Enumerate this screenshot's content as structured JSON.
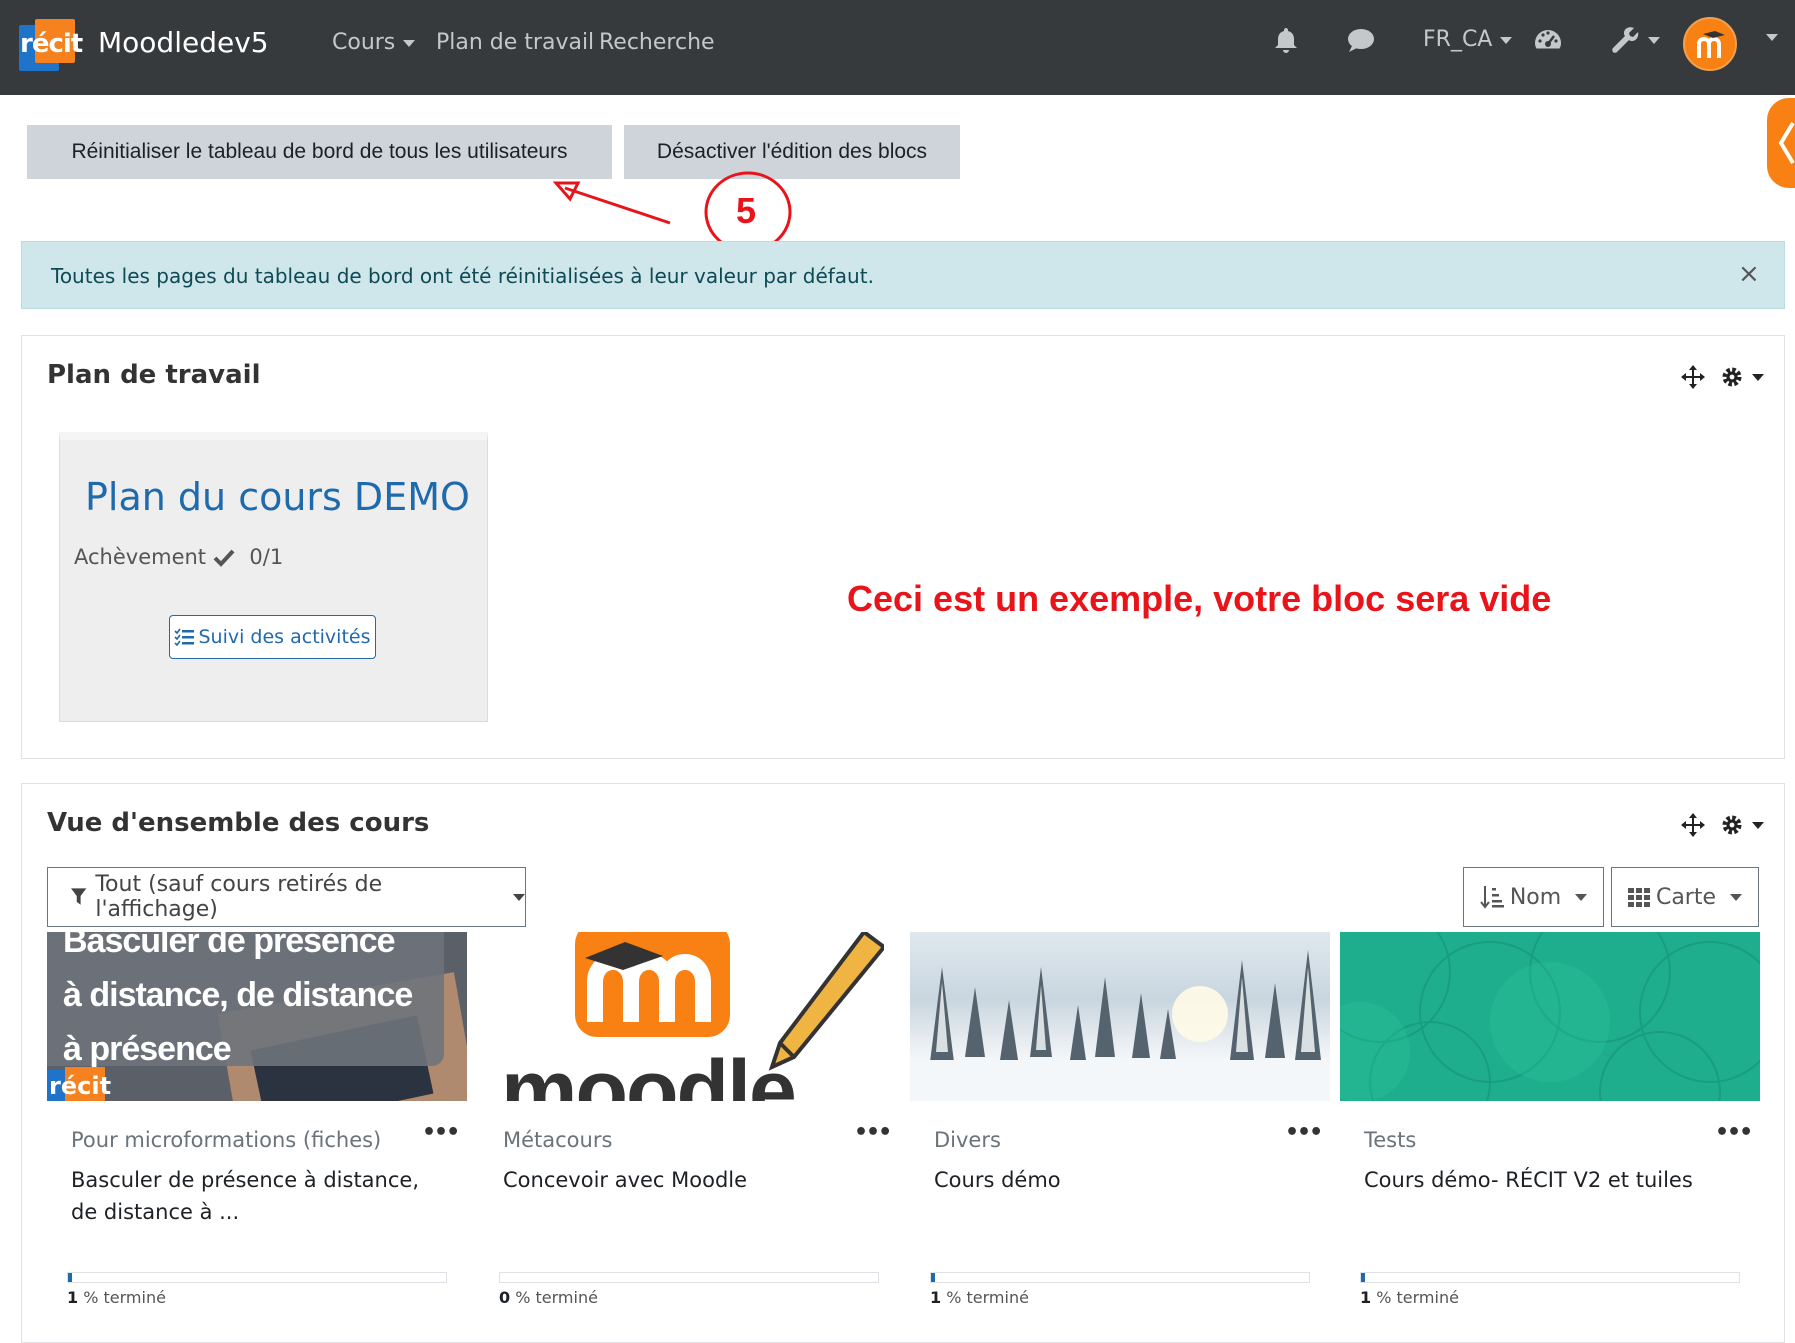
{
  "navbar": {
    "logo_text": "récit",
    "site_name": "Moodledev5",
    "links": [
      "Cours",
      "Plan de travail",
      "Recherche"
    ],
    "language": "FR_CA",
    "icons": [
      "bell-icon",
      "chat-icon",
      "dashboard-icon",
      "wrench-icon",
      "avatar"
    ]
  },
  "toolbar": {
    "reset_label": "Réinitialiser le tableau de bord de tous les utilisateurs",
    "disable_edit_label": "Désactiver l'édition des blocs"
  },
  "annotation": {
    "step_number": "5",
    "note": "Ceci est un exemple, votre bloc sera vide"
  },
  "alert": {
    "message": "Toutes les pages du tableau de bord ont été réinitialisées à leur valeur par défaut.",
    "close": "×"
  },
  "plan_block": {
    "title": "Plan de travail",
    "card": {
      "title": "Plan du cours DEMO",
      "completion_label": "Achèvement",
      "completion_value": "0/1",
      "button_label": "Suivi des activités"
    }
  },
  "overview_block": {
    "title": "Vue d'ensemble des cours",
    "filter_label": "Tout (sauf cours retirés de l'affichage)",
    "sort_label": "Nom",
    "view_label": "Carte",
    "courses": [
      {
        "category": "Pour microformations (fiches)",
        "name": "Basculer de présence à distance, de distance à ...",
        "progress": 1,
        "progress_num": "1",
        "progress_suffix": " % terminé",
        "image_text": [
          "Basculer de présence",
          "à distance, de distance",
          "à présence"
        ],
        "image_logo": "récit"
      },
      {
        "category": "Métacours",
        "name": "Concevoir avec Moodle",
        "progress": 0,
        "progress_num": "0",
        "progress_suffix": " % terminé",
        "image_word": "moodle"
      },
      {
        "category": "Divers",
        "name": "Cours démo",
        "progress": 1,
        "progress_num": "1",
        "progress_suffix": " % terminé"
      },
      {
        "category": "Tests",
        "name": "Cours démo- RÉCIT V2 et tuiles",
        "progress": 1,
        "progress_num": "1",
        "progress_suffix": " % terminé"
      }
    ]
  },
  "colors": {
    "navbar": "#373a3c",
    "accent_orange": "#f98012",
    "link_blue": "#1f6aad",
    "alert_bg": "#cfe6ea",
    "annotation_red": "#e8141a"
  }
}
